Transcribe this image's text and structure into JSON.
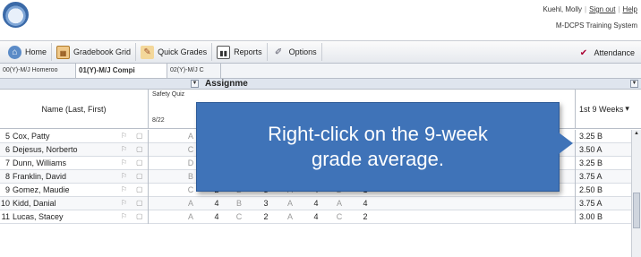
{
  "header": {
    "user_name": "Kuehl, Molly",
    "sign_out": "Sign out",
    "help": "Help",
    "system_name": "M-DCPS Training System",
    "logo_icon": "district-seal"
  },
  "toolbar": {
    "home": "Home",
    "gradebook_grid": "Gradebook Grid",
    "quick_grades": "Quick Grades",
    "reports": "Reports",
    "options": "Options",
    "attendance": "Attendance"
  },
  "tabs": [
    {
      "label": "00(Y)-M/J Homeroo"
    },
    {
      "label": "01(Y)-M/J Compi"
    },
    {
      "label": "02(Y)-M/J C"
    }
  ],
  "grid": {
    "assignments_header": "Assignme",
    "name_header": "Name (Last, First)",
    "assignment_title": "Safety Quiz",
    "assignment_date": "8/22",
    "nine_weeks_header": "1st 9 Weeks"
  },
  "students": [
    {
      "num": "5",
      "name": "Cox, Patty",
      "grades": [
        "A",
        "",
        "",
        "",
        "",
        "",
        "",
        ""
      ],
      "avg": "3.25 B"
    },
    {
      "num": "6",
      "name": "Dejesus, Norberto",
      "grades": [
        "C",
        "",
        "",
        "",
        "",
        "",
        "",
        ""
      ],
      "avg": "3.50 A"
    },
    {
      "num": "7",
      "name": "Dunn, Williams",
      "grades": [
        "D",
        "",
        "",
        "",
        "",
        "",
        "",
        ""
      ],
      "avg": "3.25 B"
    },
    {
      "num": "8",
      "name": "Franklin, David",
      "grades": [
        "B",
        "",
        "",
        "",
        "",
        "",
        "",
        ""
      ],
      "avg": "3.75 A"
    },
    {
      "num": "9",
      "name": "Gomez, Maudie",
      "grades": [
        "C",
        "2",
        "B",
        "3",
        "A",
        "4",
        "D",
        "1"
      ],
      "avg": "2.50 B"
    },
    {
      "num": "10",
      "name": "Kidd, Danial",
      "grades": [
        "A",
        "4",
        "B",
        "3",
        "A",
        "4",
        "A",
        "4"
      ],
      "avg": "3.75 A"
    },
    {
      "num": "11",
      "name": "Lucas, Stacey",
      "grades": [
        "A",
        "4",
        "C",
        "2",
        "A",
        "4",
        "C",
        "2"
      ],
      "avg": "3.00 B"
    }
  ],
  "callout": {
    "text": "Right-click on the 9-week grade average."
  },
  "colors": {
    "callout_bg": "#3f73b8",
    "toolbar_bg": "#e6e9ee"
  }
}
